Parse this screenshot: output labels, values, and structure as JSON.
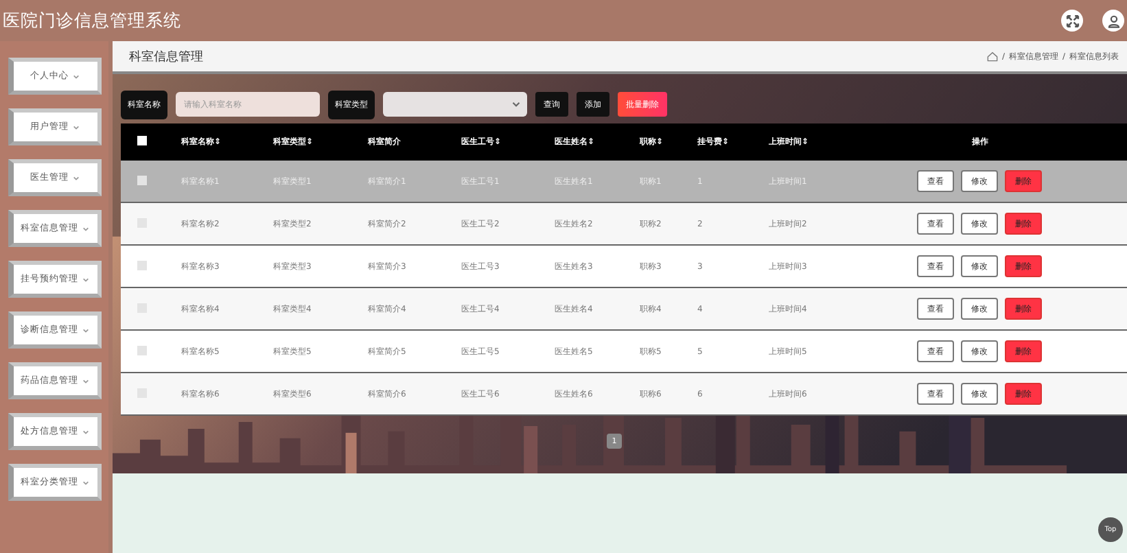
{
  "header": {
    "title": "医院门诊信息管理系统"
  },
  "sidebar": {
    "items": [
      {
        "label": "个人中心"
      },
      {
        "label": "用户管理"
      },
      {
        "label": "医生管理"
      },
      {
        "label": "科室信息管理"
      },
      {
        "label": "挂号预约管理"
      },
      {
        "label": "诊断信息管理"
      },
      {
        "label": "药品信息管理"
      },
      {
        "label": "处方信息管理"
      },
      {
        "label": "科室分类管理"
      }
    ]
  },
  "page": {
    "title": "科室信息管理",
    "breadcrumb": [
      {
        "separator": "/",
        "label": "科室信息管理"
      },
      {
        "separator": "/",
        "label": "科室信息列表"
      }
    ]
  },
  "filters": {
    "name_label": "科室名称",
    "name_placeholder": "请输入科室名称",
    "type_label": "科室类型",
    "buttons": [
      {
        "label": "查询",
        "kind": "dark"
      },
      {
        "label": "添加",
        "kind": "dark"
      },
      {
        "label": "批量删除",
        "kind": "danger"
      }
    ]
  },
  "table": {
    "select_all_checked": false,
    "columns": [
      "科室名称⇕",
      "科室类型⇕",
      "科室简介",
      "医生工号⇕",
      "医生姓名⇕",
      "职称⇕",
      "挂号费⇕",
      "上班时间⇕",
      "操作"
    ],
    "rows": [
      {
        "selected": true,
        "checked": false,
        "cells": [
          "科室名称1",
          "科室类型1",
          "科室简介1",
          "医生工号1",
          "医生姓名1",
          "职称1",
          "1",
          "上班时间1"
        ],
        "actions": [
          {
            "label": "查看",
            "kind": "outline"
          },
          {
            "label": "修改",
            "kind": "outline"
          },
          {
            "label": "删除",
            "kind": "danger"
          }
        ]
      },
      {
        "selected": false,
        "checked": false,
        "cells": [
          "科室名称2",
          "科室类型2",
          "科室简介2",
          "医生工号2",
          "医生姓名2",
          "职称2",
          "2",
          "上班时间2"
        ],
        "actions": [
          {
            "label": "查看",
            "kind": "outline"
          },
          {
            "label": "修改",
            "kind": "outline"
          },
          {
            "label": "删除",
            "kind": "danger"
          }
        ]
      },
      {
        "selected": false,
        "checked": false,
        "cells": [
          "科室名称3",
          "科室类型3",
          "科室简介3",
          "医生工号3",
          "医生姓名3",
          "职称3",
          "3",
          "上班时间3"
        ],
        "actions": [
          {
            "label": "查看",
            "kind": "outline"
          },
          {
            "label": "修改",
            "kind": "outline"
          },
          {
            "label": "删除",
            "kind": "danger"
          }
        ]
      },
      {
        "selected": false,
        "checked": false,
        "cells": [
          "科室名称4",
          "科室类型4",
          "科室简介4",
          "医生工号4",
          "医生姓名4",
          "职称4",
          "4",
          "上班时间4"
        ],
        "actions": [
          {
            "label": "查看",
            "kind": "outline"
          },
          {
            "label": "修改",
            "kind": "outline"
          },
          {
            "label": "删除",
            "kind": "danger"
          }
        ]
      },
      {
        "selected": false,
        "checked": false,
        "cells": [
          "科室名称5",
          "科室类型5",
          "科室简介5",
          "医生工号5",
          "医生姓名5",
          "职称5",
          "5",
          "上班时间5"
        ],
        "actions": [
          {
            "label": "查看",
            "kind": "outline"
          },
          {
            "label": "修改",
            "kind": "outline"
          },
          {
            "label": "删除",
            "kind": "danger"
          }
        ]
      },
      {
        "selected": false,
        "checked": false,
        "cells": [
          "科室名称6",
          "科室类型6",
          "科室简介6",
          "医生工号6",
          "医生姓名6",
          "职称6",
          "6",
          "上班时间6"
        ],
        "actions": [
          {
            "label": "查看",
            "kind": "outline"
          },
          {
            "label": "修改",
            "kind": "outline"
          },
          {
            "label": "删除",
            "kind": "danger"
          }
        ]
      }
    ]
  },
  "pagination": {
    "pages": [
      {
        "label": "1",
        "selected": true
      }
    ]
  },
  "back_to_top": "Top"
}
